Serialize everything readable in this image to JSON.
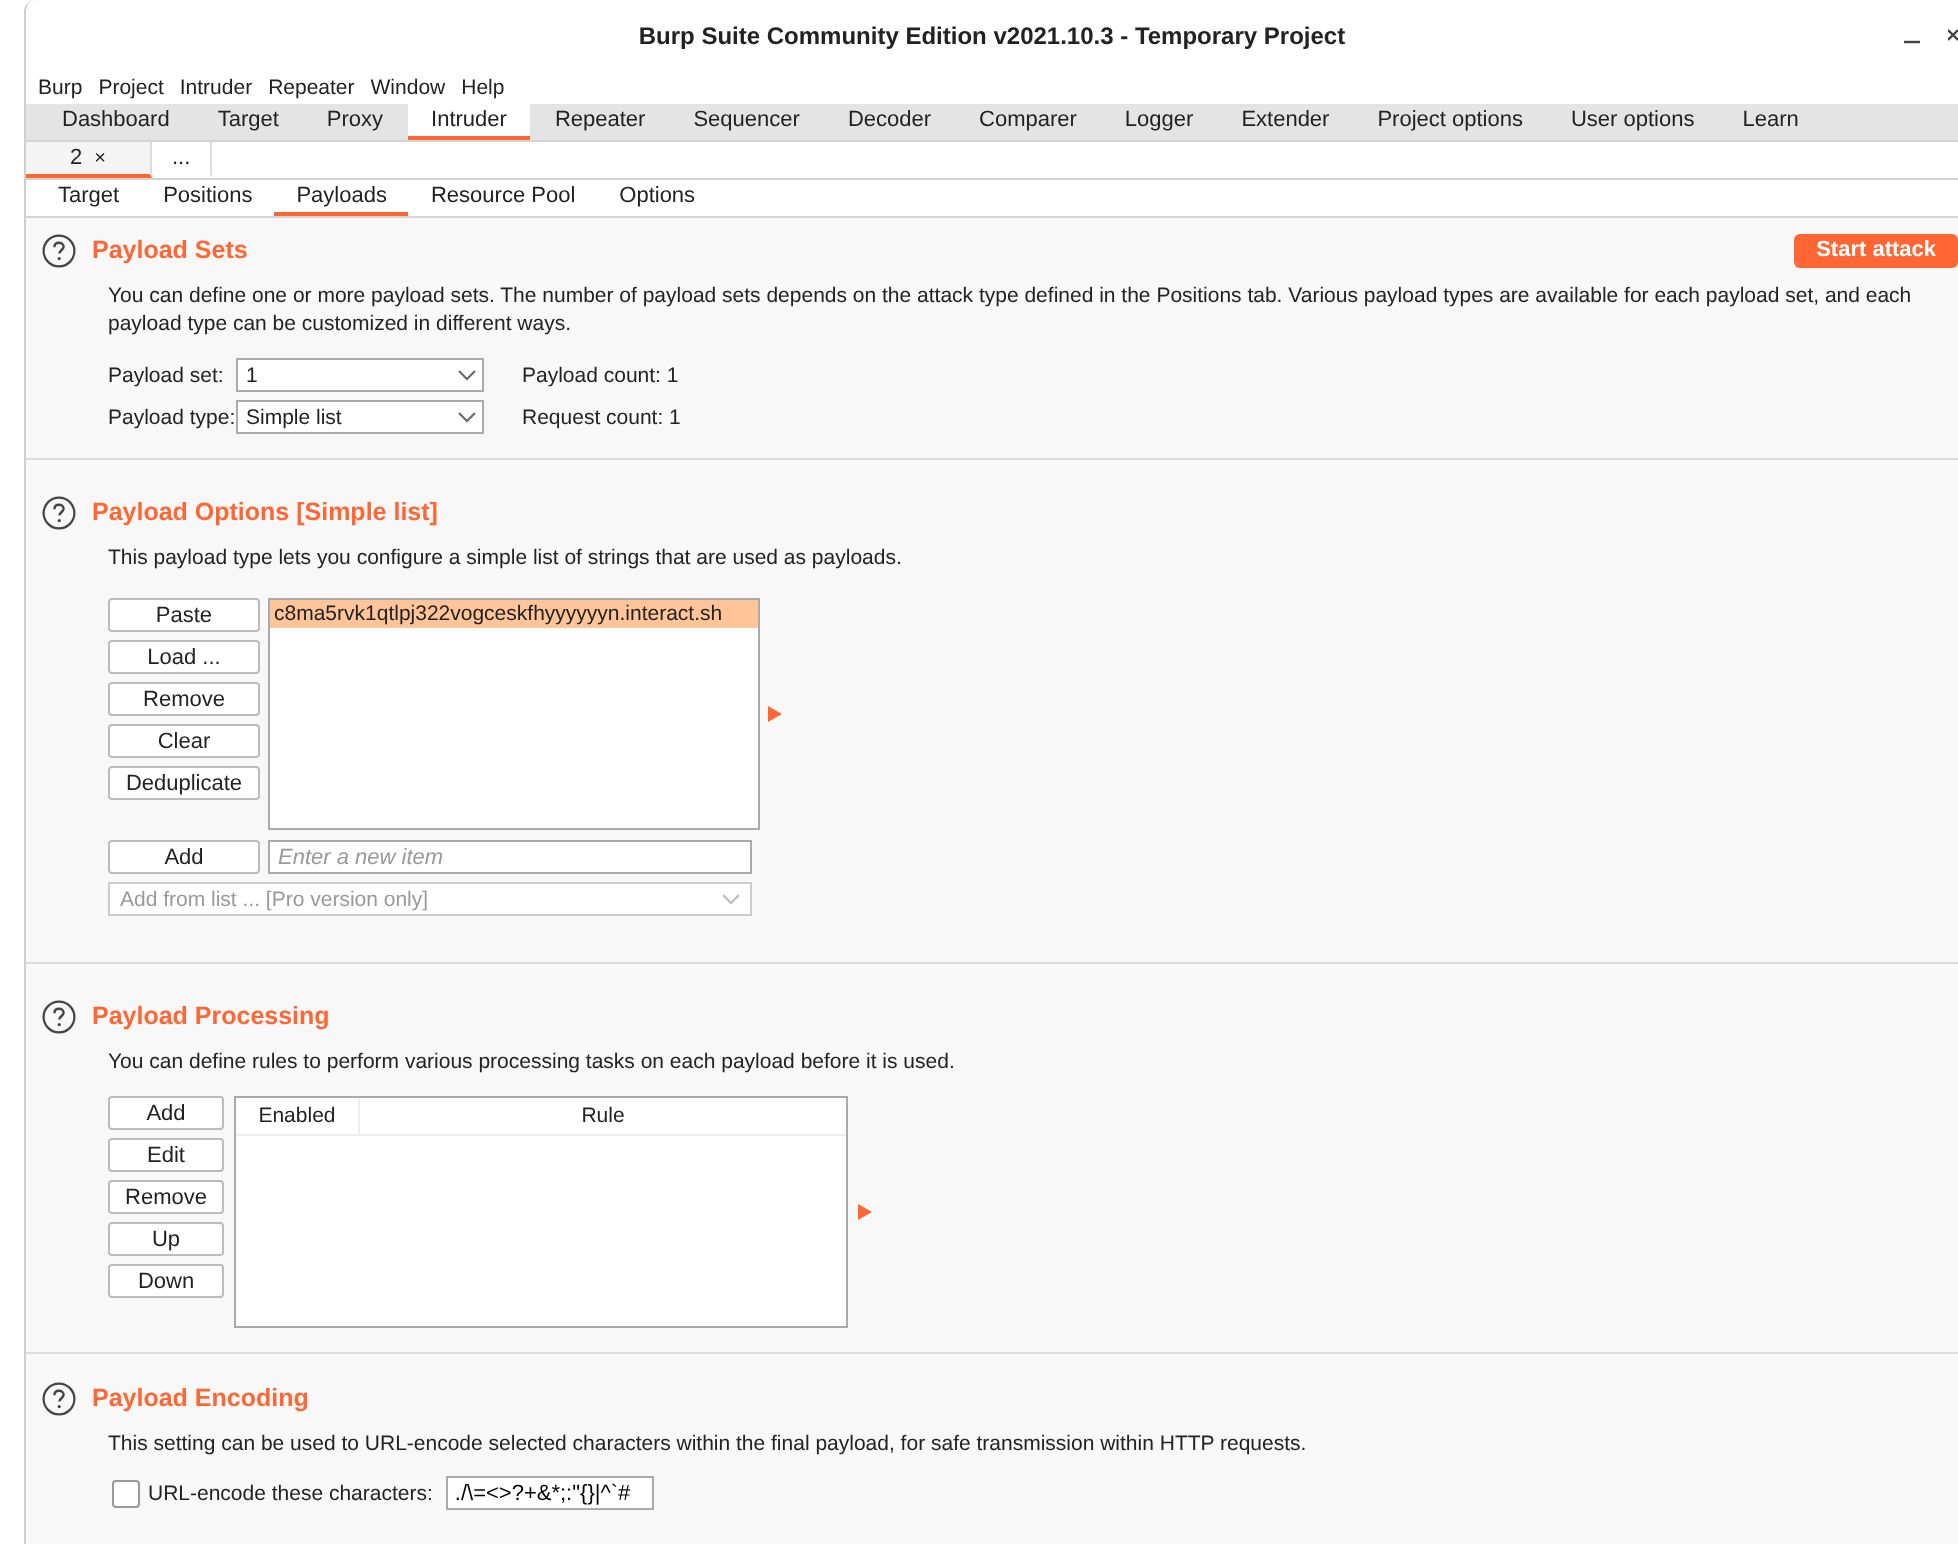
{
  "window": {
    "title": "Burp Suite Community Edition v2021.10.3 - Temporary Project"
  },
  "menu": [
    "Burp",
    "Project",
    "Intruder",
    "Repeater",
    "Window",
    "Help"
  ],
  "main_tabs": [
    {
      "label": "Dashboard",
      "selected": false
    },
    {
      "label": "Target",
      "selected": false
    },
    {
      "label": "Proxy",
      "selected": false
    },
    {
      "label": "Intruder",
      "selected": true
    },
    {
      "label": "Repeater",
      "selected": false
    },
    {
      "label": "Sequencer",
      "selected": false
    },
    {
      "label": "Decoder",
      "selected": false
    },
    {
      "label": "Comparer",
      "selected": false
    },
    {
      "label": "Logger",
      "selected": false
    },
    {
      "label": "Extender",
      "selected": false
    },
    {
      "label": "Project options",
      "selected": false
    },
    {
      "label": "User options",
      "selected": false
    },
    {
      "label": "Learn",
      "selected": false
    }
  ],
  "attack_tabs": [
    {
      "label": "2",
      "close": "×",
      "selected": true
    },
    {
      "label": "...",
      "selected": false
    }
  ],
  "sub_tabs": [
    {
      "label": "Target",
      "selected": false
    },
    {
      "label": "Positions",
      "selected": false
    },
    {
      "label": "Payloads",
      "selected": true
    },
    {
      "label": "Resource Pool",
      "selected": false
    },
    {
      "label": "Options",
      "selected": false
    }
  ],
  "payload_sets": {
    "title": "Payload Sets",
    "start_button": "Start attack",
    "description": "You can define one or more payload sets. The number of payload sets depends on the attack type defined in the Positions tab. Various payload types are available for each payload set, and each payload type can be customized in different ways.",
    "rows": [
      {
        "label": "Payload set:",
        "value": "1",
        "info": "Payload count: 1"
      },
      {
        "label": "Payload type:",
        "value": "Simple list",
        "info": "Request count: 1"
      }
    ]
  },
  "payload_options": {
    "title": "Payload Options [Simple list]",
    "description": "This payload type lets you configure a simple list of strings that are used as payloads.",
    "buttons": [
      "Paste",
      "Load ...",
      "Remove",
      "Clear",
      "Deduplicate"
    ],
    "items": [
      {
        "text": "c8ma5rvk1qtlpj322vogceskfhyyyyyyn.interact.sh",
        "selected": true
      }
    ],
    "add_button": "Add",
    "new_item": {
      "placeholder": "Enter a new item"
    },
    "add_from_list": {
      "value": "Add from list ... [Pro version only]",
      "disabled": true
    }
  },
  "payload_processing": {
    "title": "Payload Processing",
    "description": "You can define rules to perform various processing tasks on each payload before it is used.",
    "buttons": [
      "Add",
      "Edit",
      "Remove",
      "Up",
      "Down"
    ],
    "columns": [
      "Enabled",
      "Rule"
    ]
  },
  "payload_encoding": {
    "title": "Payload Encoding",
    "description": "This setting can be used to URL-encode selected characters within the final payload, for safe transmission within HTTP requests.",
    "checkbox": {
      "label": "URL-encode these characters:",
      "checked": false
    },
    "characters": "./\\=<>?+&*;:\"{}|^`#"
  }
}
